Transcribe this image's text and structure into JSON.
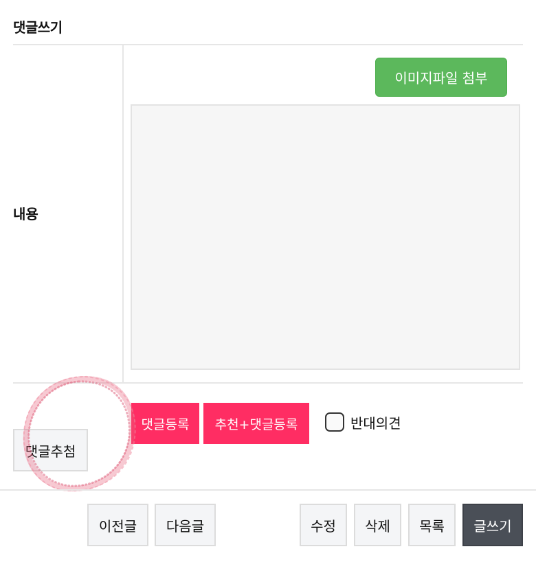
{
  "comment_form": {
    "title": "댓글쓰기",
    "content_label": "내용",
    "attach_button": "이미지파일 첨부",
    "textarea_value": "",
    "recommend_button": "댓글추첨",
    "register_button": "댓글등록",
    "recommend_register_button": "추천+댓글등록",
    "oppose_checkbox_label": "반대의견",
    "oppose_checked": false
  },
  "bottom_nav": {
    "prev": "이전글",
    "next": "다음글",
    "edit": "수정",
    "delete": "삭제",
    "list": "목록",
    "write": "글쓰기"
  },
  "colors": {
    "attach_green": "#5cb85c",
    "register_pink": "#ff2d63",
    "write_dark": "#4a4f57",
    "annotation_circle": "#e8657f"
  }
}
